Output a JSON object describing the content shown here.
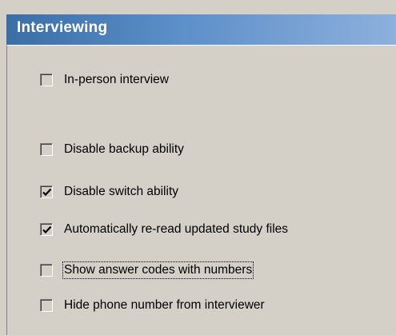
{
  "panel": {
    "title": "Interviewing"
  },
  "options": [
    {
      "label": "In-person interview",
      "checked": false
    },
    {
      "label": "Disable backup ability",
      "checked": false
    },
    {
      "label": "Disable switch ability",
      "checked": true
    },
    {
      "label": "Automatically re-read updated study files",
      "checked": true
    },
    {
      "label": "Show answer codes with numbers",
      "checked": false,
      "focused": true
    },
    {
      "label": "Hide phone number from interviewer",
      "checked": false
    }
  ]
}
